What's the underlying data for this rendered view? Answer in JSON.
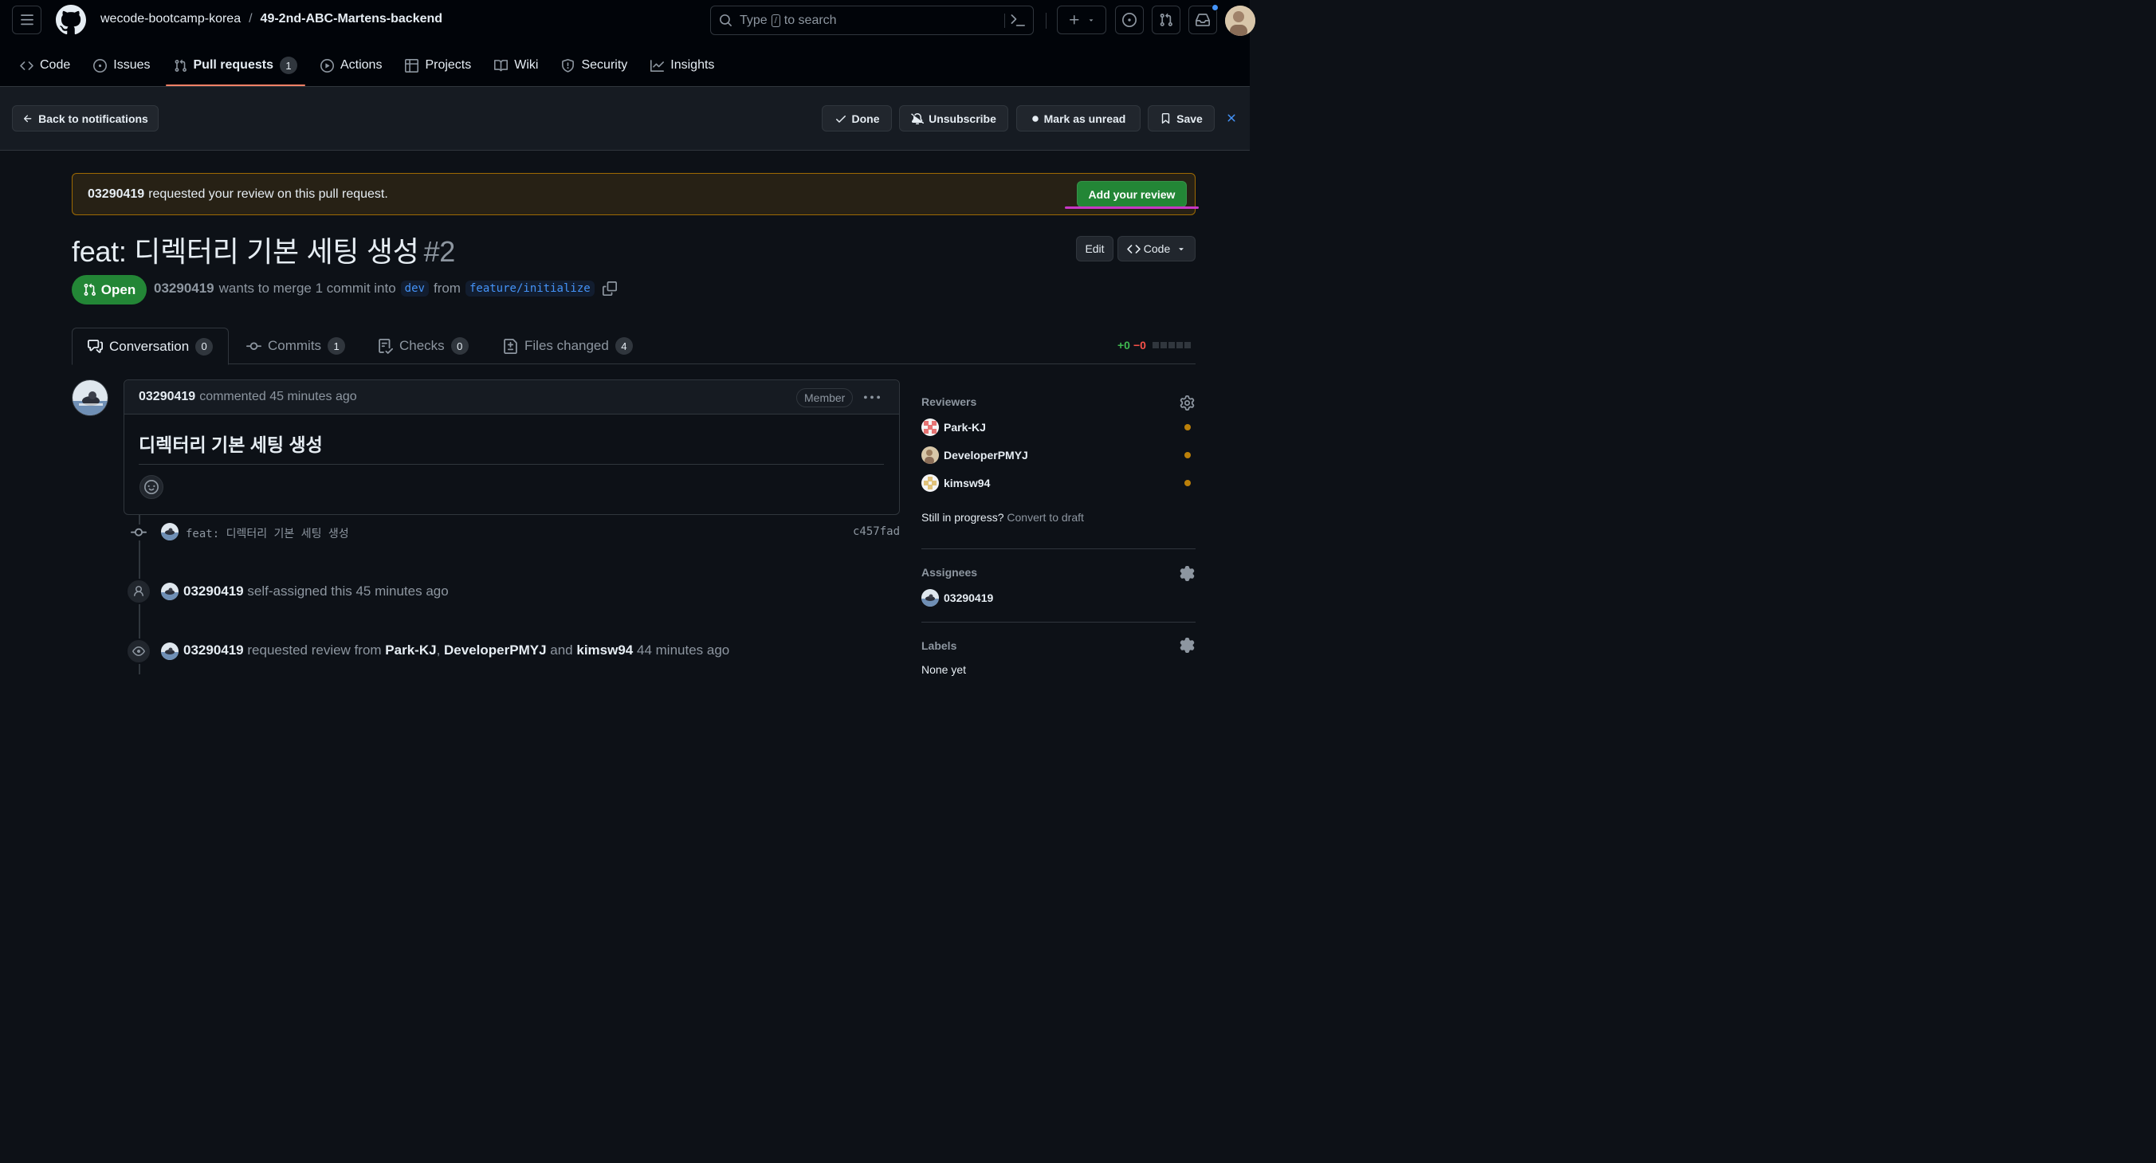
{
  "header": {
    "org": "wecode-bootcamp-korea",
    "separator": "/",
    "repo": "49-2nd-ABC-Martens-backend",
    "search_pre": "Type",
    "search_key": "/",
    "search_post": "to search"
  },
  "nav": {
    "code": "Code",
    "issues": "Issues",
    "pulls": "Pull requests",
    "pulls_count": "1",
    "actions": "Actions",
    "projects": "Projects",
    "wiki": "Wiki",
    "security": "Security",
    "insights": "Insights"
  },
  "notification_bar": {
    "back": "Back to notifications",
    "done": "Done",
    "unsubscribe": "Unsubscribe",
    "mark_unread": "Mark as unread",
    "save": "Save"
  },
  "banner": {
    "user": "03290419",
    "text": "requested your review on this pull request.",
    "button": "Add your review"
  },
  "pr": {
    "title": "feat: 디렉터리 기본 세팅 생성",
    "number": "#2",
    "edit": "Edit",
    "code": "Code",
    "state": "Open",
    "author": "03290419",
    "merge_text": "wants to merge 1 commit into",
    "base": "dev",
    "from": "from",
    "head": "feature/initialize"
  },
  "tabs": {
    "conversation": "Conversation",
    "conversation_count": "0",
    "commits": "Commits",
    "commits_count": "1",
    "checks": "Checks",
    "checks_count": "0",
    "files": "Files changed",
    "files_count": "4",
    "additions": "+0",
    "deletions": "−0"
  },
  "comment": {
    "author": "03290419",
    "meta": "commented 45 minutes ago",
    "badge": "Member",
    "body": "디렉터리 기본 세팅 생성"
  },
  "timeline": {
    "commit_msg": "feat: 디렉터리 기본 세팅 생성",
    "commit_sha": "c457fad",
    "assign_user": "03290419",
    "assign_text": "self-assigned this 45 minutes ago",
    "review_user": "03290419",
    "review_text": "requested review from",
    "reviewer1": "Park-KJ",
    "comma": ",",
    "reviewer2": "DeveloperPMYJ",
    "and": "and",
    "reviewer3": "kimsw94",
    "review_time": "44 minutes ago"
  },
  "sidebar": {
    "reviewers_label": "Reviewers",
    "reviewers": [
      "Park-KJ",
      "DeveloperPMYJ",
      "kimsw94"
    ],
    "still_in_progress": "Still in progress?",
    "convert_draft": "Convert to draft",
    "assignees_label": "Assignees",
    "assignee": "03290419",
    "labels_label": "Labels",
    "labels_value": "None yet"
  },
  "colors": {
    "accent_green": "#238636",
    "pending_dot": "#bb8009",
    "tab_underline": "#f78166",
    "highlight_underline": "#c837c6"
  }
}
